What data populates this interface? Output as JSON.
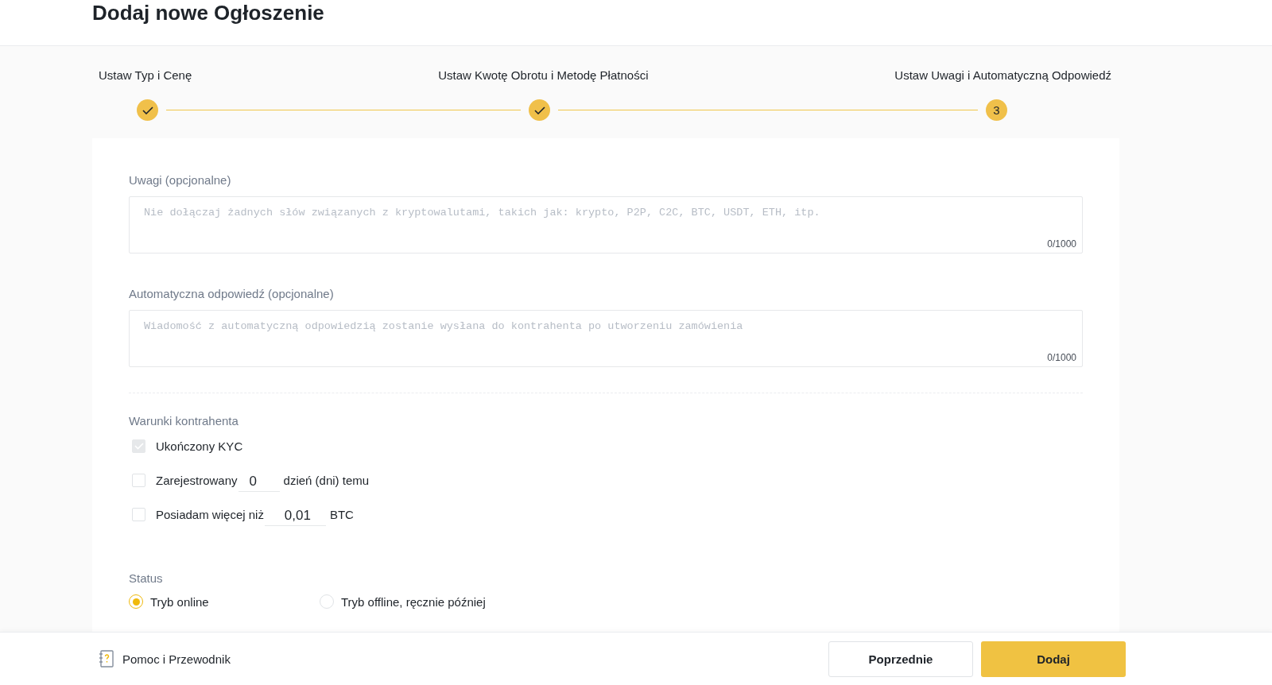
{
  "page_title": "Dodaj nowe Ogłoszenie",
  "steps": [
    {
      "label": "Ustaw Typ i Cenę",
      "done": true
    },
    {
      "label": "Ustaw Kwotę Obrotu i Metodę Płatności",
      "done": true
    },
    {
      "label": "Ustaw Uwagi i Automatyczną Odpowiedź",
      "done": false,
      "number": "3"
    }
  ],
  "fields": [
    {
      "label": "Uwagi (opcjonalne)",
      "placeholder": "Nie dołączaj żadnych słów związanych z kryptowalutami, takich jak: krypto, P2P, C2C, BTC, USDT, ETH, itp.",
      "counter": "0/1000"
    },
    {
      "label": "Automatyczna odpowiedź (opcjonalne)",
      "placeholder": "Wiadomość z automatyczną odpowiedzią zostanie wysłana do kontrahenta po utworzeniu zamówienia",
      "counter": "0/1000"
    }
  ],
  "conditions": {
    "title": "Warunki kontrahenta",
    "items": [
      {
        "kind": "plain",
        "label": "Ukończony KYC",
        "checked": true,
        "disabled": true
      },
      {
        "kind": "input",
        "label": "Zarejestrowany",
        "value": "0",
        "suffix": "dzień (dni) temu",
        "checked": false,
        "disabled": false
      },
      {
        "kind": "input",
        "label": "Posiadam więcej niż",
        "value": "0,01",
        "suffix": "BTC",
        "checked": false,
        "disabled": false
      }
    ]
  },
  "status": {
    "title": "Status",
    "options": [
      {
        "label": "Tryb online",
        "selected": true
      },
      {
        "label": "Tryb offline, ręcznie później",
        "selected": false
      }
    ]
  },
  "footer": {
    "help": "Pomoc i Przewodnik",
    "buttons": [
      {
        "label": "Poprzednie",
        "kind": "secondary"
      },
      {
        "label": "Dodaj",
        "kind": "primary"
      }
    ]
  }
}
